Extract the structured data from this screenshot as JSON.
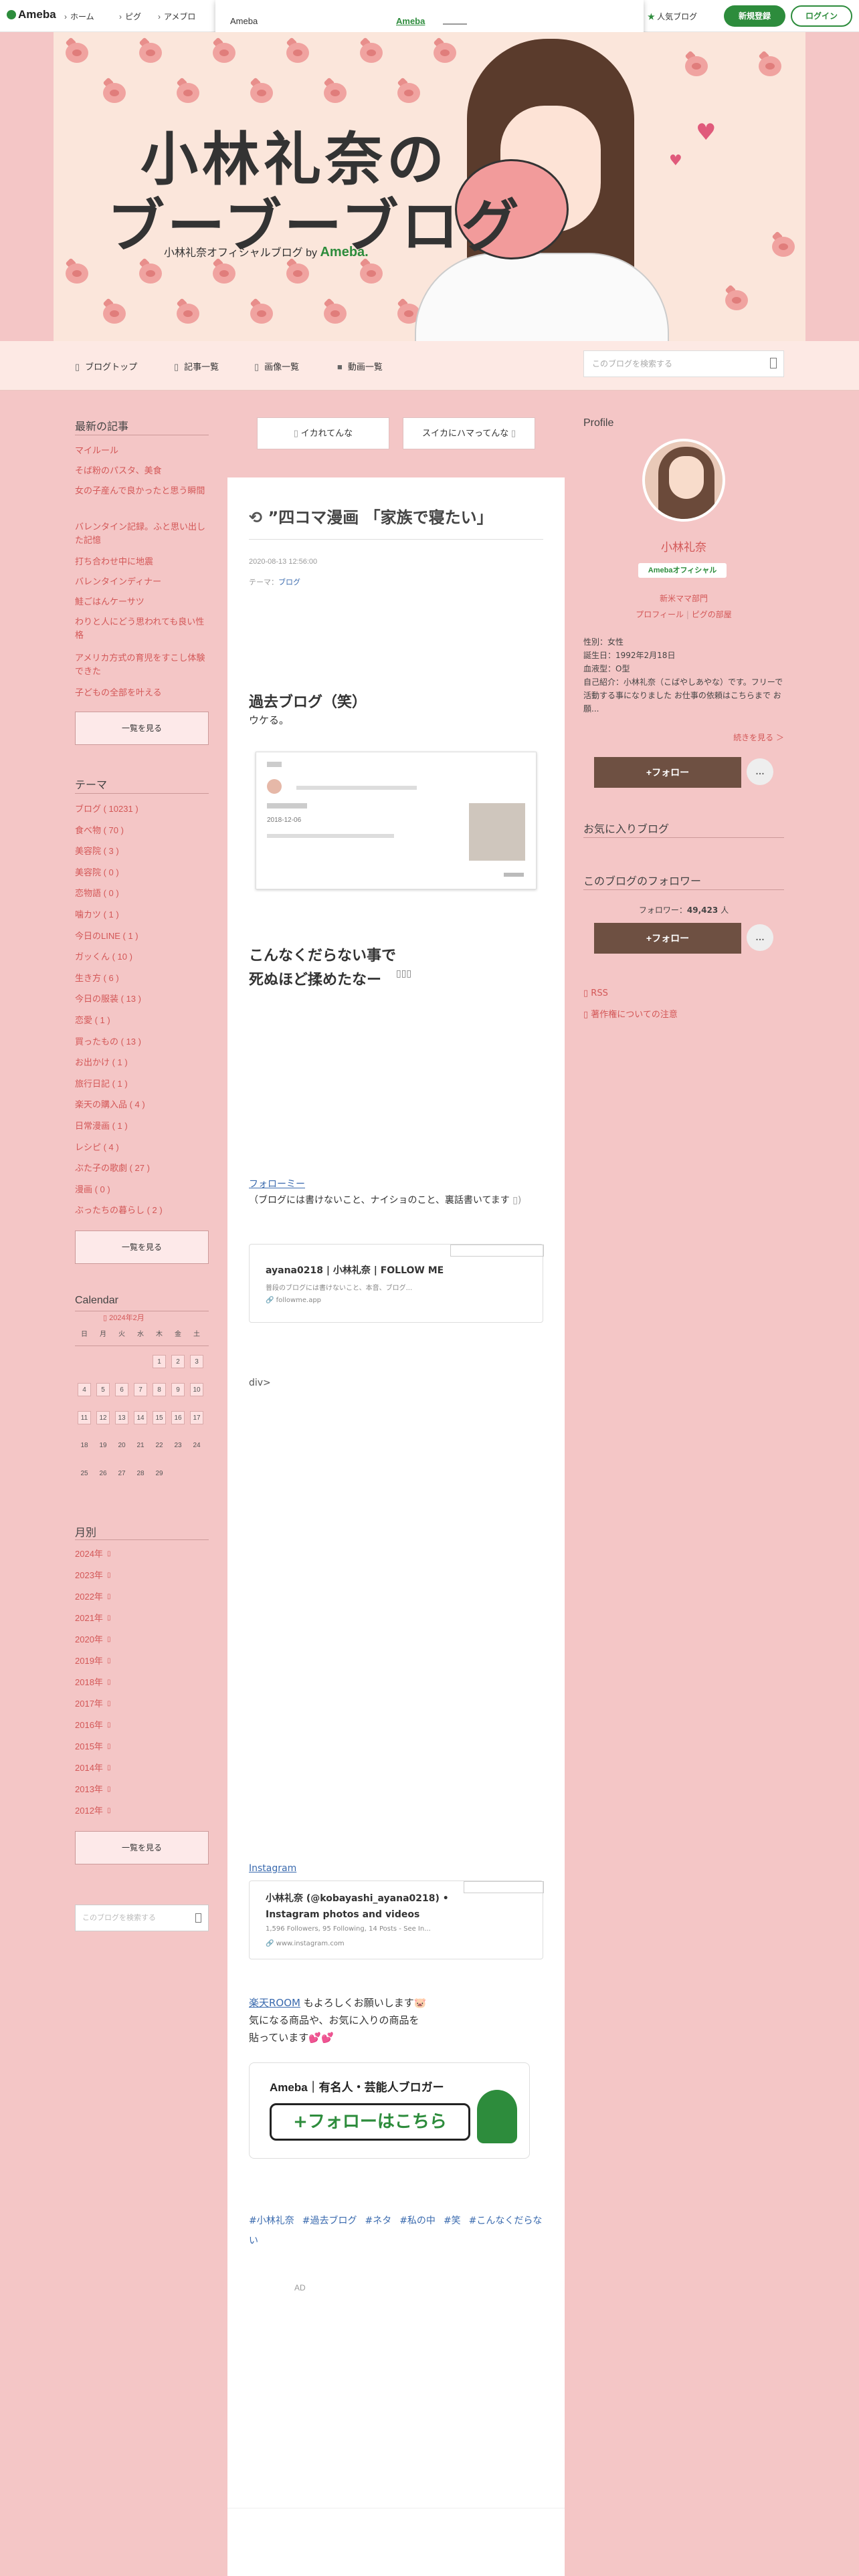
{
  "topbar": {
    "logo": "Ameba",
    "nav": [
      "ホーム",
      "ピグ",
      "アメブロ"
    ],
    "popular": "人気ブログ",
    "signup": "新規登録",
    "login": "ログイン"
  },
  "popup": {
    "title": "Ameba",
    "link": "Ameba",
    "close": "× ○○"
  },
  "header": {
    "title_line1": "小林礼奈の",
    "title_line2": "ブーブーブログ",
    "subtitle": "小林礼奈オフィシャルブログ by",
    "subtitle_brand": "Ameba."
  },
  "nav": {
    "items": [
      "ブログトップ",
      "記事一覧",
      "画像一覧",
      "動画一覧"
    ],
    "search_placeholder": "このブログを検索する"
  },
  "pager": {
    "prev": "イカれてんな",
    "next": "スイカにハマってんな"
  },
  "article": {
    "title": "”四コマ漫画 「家族で寝たい」",
    "date": "2020-08-13 12:56:00",
    "theme_label": "テーマ：",
    "theme": "ブログ",
    "heading1": "過去ブログ（笑）",
    "text1": "ウケる。",
    "embed_date": "2018-12-06",
    "heading2_line1": "こんなくだらない事で",
    "heading2_line2": "死ぬほど揉めたなー",
    "followme_link": "フォローミー",
    "followme_text": "（ブログには書けないこと、ナイショのこと、裏話書いてます",
    "card1_title": "ayana0218 | 小林礼奈 | FOLLOW ME",
    "card1_desc": "普段のブログには書けないこと、本音、ブログ...",
    "card1_url": "followme.app",
    "div_text": "div>",
    "instagram_link": "Instagram",
    "card2_title": "小林礼奈 (@kobayashi_ayana0218) • Instagram photos and videos",
    "card2_desc": "1,596 Followers, 95 Following, 14 Posts - See In...",
    "card2_url": "www.instagram.com",
    "rakuten_link": "楽天ROOM",
    "rakuten_text1": " もよろしくお願いします",
    "rakuten_text2": "気になる商品や、お気に入りの商品を",
    "rakuten_text3": "貼っています",
    "banner_top": "Ameba｜有名人・芸能人ブロガー",
    "banner_btn": "+フォローはこちら",
    "tags": [
      "#小林礼奈",
      "#過去ブログ",
      "#ネタ",
      "#私の中",
      "#笑",
      "#こんなくだらない"
    ],
    "ad": "AD"
  },
  "left": {
    "recent_title": "最新の記事",
    "recent": [
      "マイルール",
      "そば粉のパスタ、美食",
      "女の子産んで良かったと思う瞬間",
      "バレンタイン記録。ふと思い出した記憶",
      "打ち合わせ中に地震",
      "バレンタインディナー",
      "鮭ごはんケーサツ",
      "わりと人にどう思われても良い性格",
      "アメリカ方式の育児をすこし体験できた",
      "子どもの全部を叶える"
    ],
    "recent_more": "一覧を見る",
    "theme_title": "テーマ",
    "themes": [
      "ブログ ( 10231 )",
      "食べ物 ( 70 )",
      "美容院 ( 3 )",
      "美容院 ( 0 )",
      "恋物語 ( 0 )",
      "噛カツ ( 1 )",
      "今日のLINE ( 1 )",
      "ガッくん ( 10 )",
      "生き方 ( 6 )",
      "今日の服装 ( 13 )",
      "恋愛 ( 1 )",
      "買ったもの ( 13 )",
      "お出かけ ( 1 )",
      "旅行日記 ( 1 )",
      "楽天の購入品 ( 4 )",
      "日常漫画 ( 1 )",
      "レシピ ( 4 )",
      "ぶた子の歌劇 ( 27 )",
      "漫画 ( 0 )",
      "ぶったちの暮らし ( 2 )"
    ],
    "theme_more": "一覧を見る",
    "calendar_title": "Calendar",
    "calendar_month": "2024年2月",
    "weekdays": [
      "日",
      "月",
      "火",
      "水",
      "木",
      "金",
      "土"
    ],
    "days": [
      "",
      "",
      "",
      "",
      "1",
      "2",
      "3",
      "4",
      "5",
      "6",
      "7",
      "8",
      "9",
      "10",
      "11",
      "12",
      "13",
      "14",
      "15",
      "16",
      "17",
      "18",
      "19",
      "20",
      "21",
      "22",
      "23",
      "24",
      "25",
      "26",
      "27",
      "28",
      "29",
      "",
      ""
    ],
    "linked_days": [
      "1",
      "2",
      "3",
      "4",
      "5",
      "6",
      "7",
      "8",
      "9",
      "10",
      "11",
      "12",
      "13",
      "14",
      "15",
      "16",
      "17"
    ],
    "month_title": "月別",
    "years": [
      "2024年",
      "2023年",
      "2022年",
      "2021年",
      "2020年",
      "2019年",
      "2018年",
      "2017年",
      "2016年",
      "2015年",
      "2014年",
      "2013年",
      "2012年"
    ],
    "month_more": "一覧を見る",
    "search_placeholder": "このブログを検索する"
  },
  "right": {
    "profile_title": "Profile",
    "name": "小林礼奈",
    "official": "Amebaオフィシャル",
    "category": "新米ママ部門",
    "profile_link": "プロフィール",
    "pig_link": "ピグの部屋",
    "gender": "性別：女性",
    "birthday": "誕生日：1992年2月18日",
    "blood": "血液型：O型",
    "intro": "自己紹介：小林礼奈（こばやしあやな）です。フリーで活動する事になりました お仕事の依頼はこちらまで お願...",
    "more": "続きを見る ＞",
    "follow": "+フォロー",
    "more_icon": "…",
    "fav_title": "お気に入りブログ",
    "followers_title": "このブログのフォロワー",
    "followers_label": "フォロワー：",
    "followers_count": "49,423",
    "followers_unit": "人",
    "rss": "RSS",
    "copyright": "著作権についての注意"
  }
}
